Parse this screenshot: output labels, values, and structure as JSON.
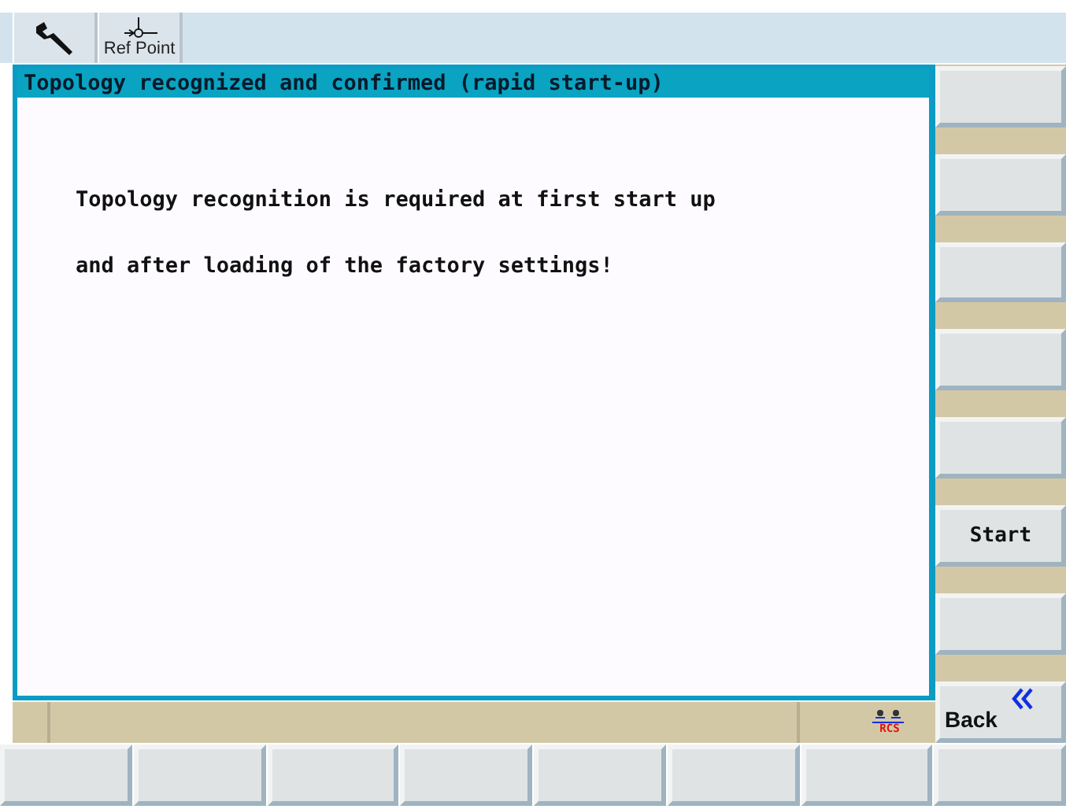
{
  "toolbar": [
    {
      "kind": "icon"
    },
    {
      "kind": "labeled",
      "label": "Ref Point"
    }
  ],
  "dialog": {
    "title": "Topology recognized and confirmed (rapid start-up)",
    "lines": [
      "Topology recognition is required at first start up",
      "and after loading of the factory settings!"
    ]
  },
  "status_bar": {
    "rcs_label": "RCS"
  },
  "vertical_softkeys": [
    {
      "kind": "blank"
    },
    {
      "kind": "blank"
    },
    {
      "kind": "blank"
    },
    {
      "kind": "blank"
    },
    {
      "kind": "blank"
    },
    {
      "kind": "text",
      "label": "Start"
    },
    {
      "kind": "blank"
    },
    {
      "kind": "back",
      "label": "Back"
    }
  ],
  "horizontal_softkeys": [
    {
      "kind": "blank"
    },
    {
      "kind": "blank"
    },
    {
      "kind": "blank"
    },
    {
      "kind": "blank"
    },
    {
      "kind": "blank"
    },
    {
      "kind": "blank"
    },
    {
      "kind": "blank"
    },
    {
      "kind": "blank"
    }
  ]
}
